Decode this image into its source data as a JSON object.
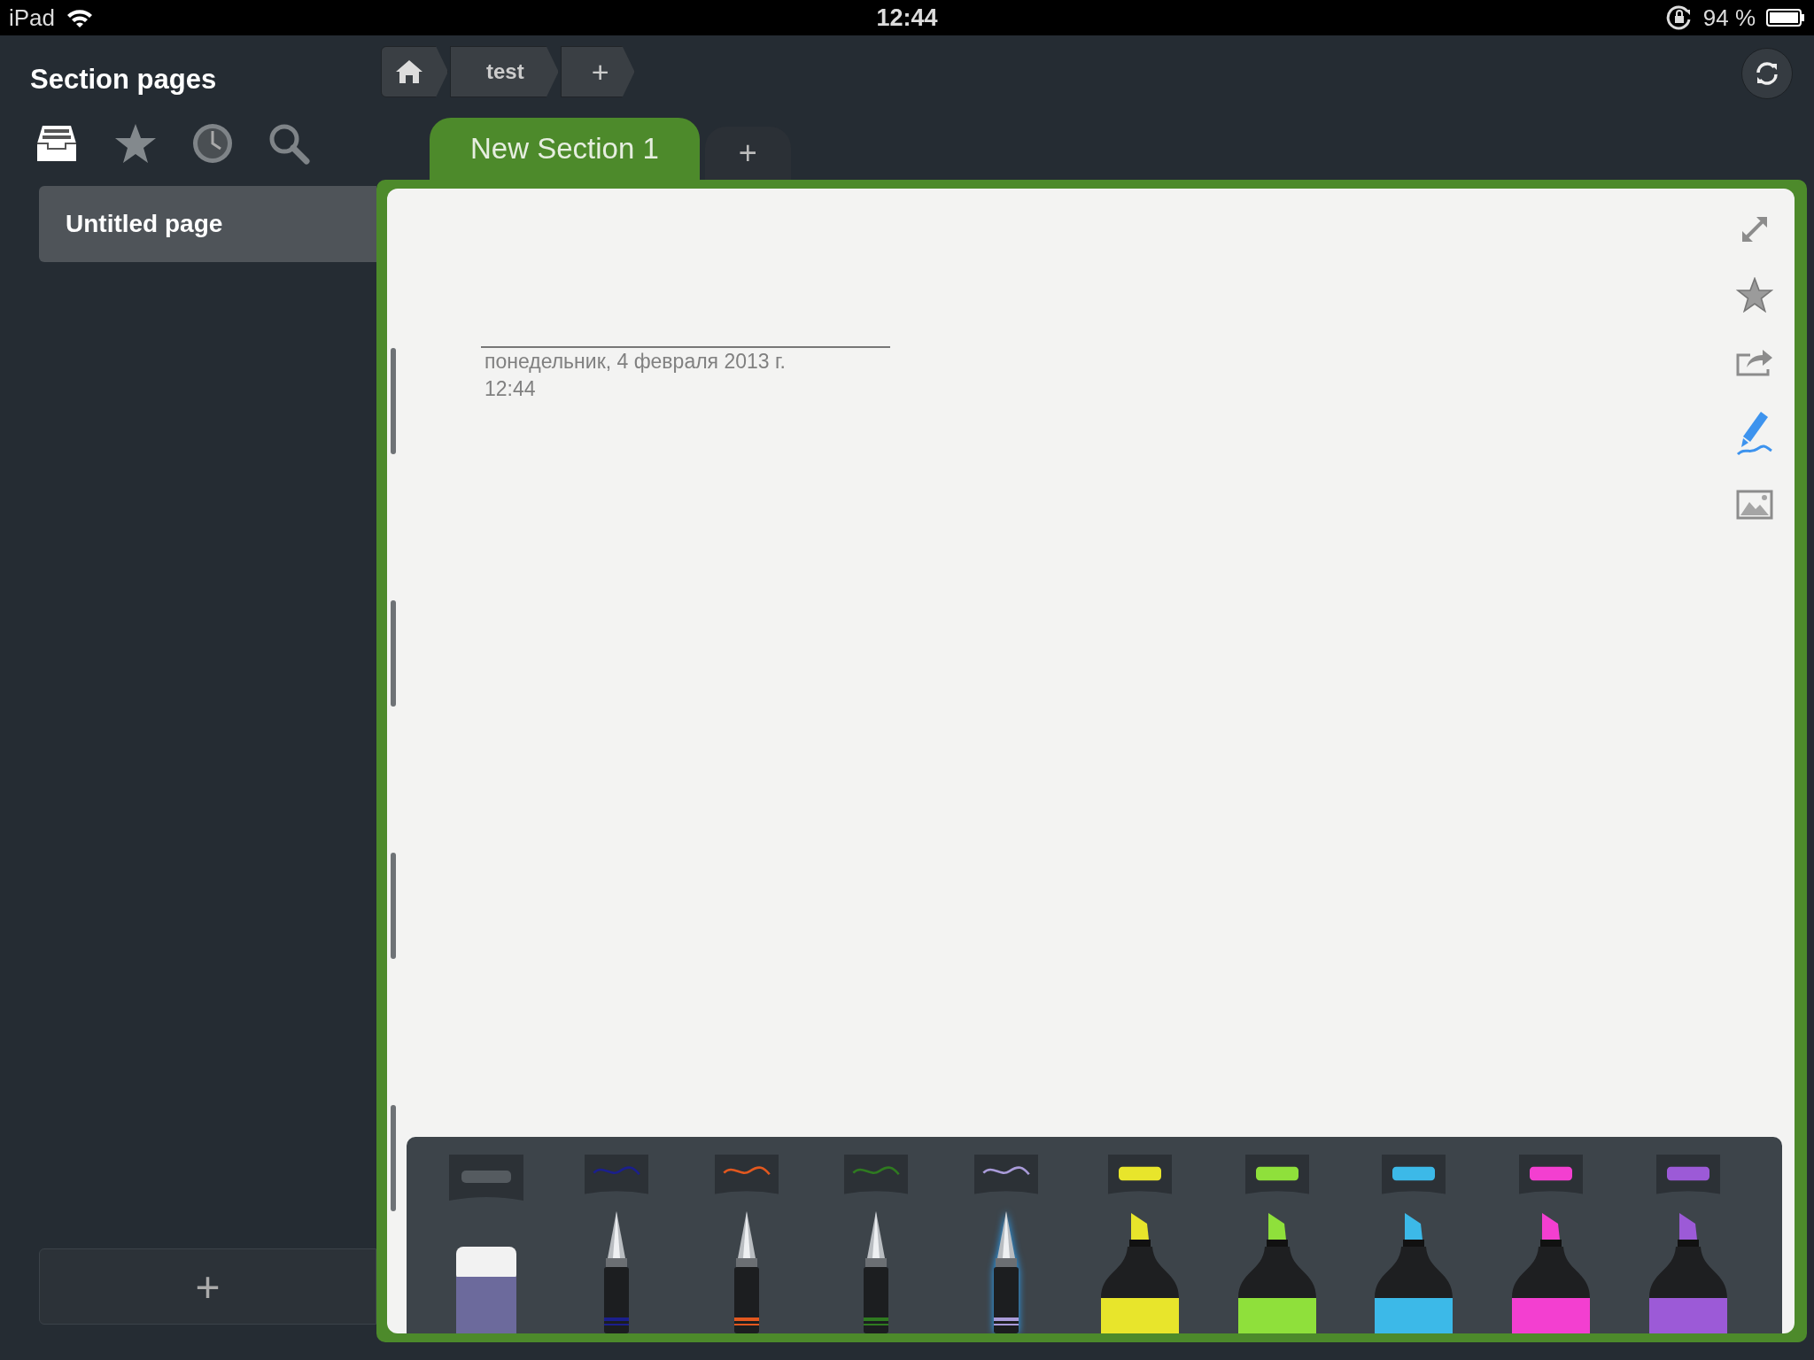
{
  "status_bar": {
    "device": "iPad",
    "time": "12:44",
    "battery": "94 %"
  },
  "sidebar": {
    "title": "Section pages",
    "view_buttons": [
      {
        "kind": "pages",
        "selected": true
      },
      {
        "kind": "favorites",
        "selected": false
      },
      {
        "kind": "recent",
        "selected": false
      },
      {
        "kind": "search",
        "selected": false
      }
    ],
    "pages": [
      {
        "label": "Untitled page",
        "selected": true
      }
    ],
    "add_button": "+"
  },
  "breadcrumb": [
    {
      "kind": "home"
    },
    {
      "kind": "notebook",
      "label": "test"
    },
    {
      "kind": "add",
      "label": "+"
    }
  ],
  "section_tabs": [
    {
      "label": "New Section 1",
      "selected": true,
      "color": "#4d8a2b"
    }
  ],
  "add_section": "+",
  "page": {
    "date": "понедельник, 4 февраля 2013 г.",
    "time": "12:44"
  },
  "page_tools": [
    {
      "kind": "expand",
      "active": false
    },
    {
      "kind": "favorite",
      "active": false
    },
    {
      "kind": "share",
      "active": false
    },
    {
      "kind": "draw",
      "active": true
    },
    {
      "kind": "picture",
      "active": false
    }
  ],
  "tools": [
    {
      "kind": "eraser",
      "color": "#555b60",
      "selected": false
    },
    {
      "kind": "pen",
      "color": "#1b1f8c",
      "selected": false
    },
    {
      "kind": "pen",
      "color": "#e2581f",
      "selected": false
    },
    {
      "kind": "pen",
      "color": "#2f7a20",
      "selected": false
    },
    {
      "kind": "pen",
      "color": "#a99bd9",
      "selected": true
    },
    {
      "kind": "highlighter",
      "color": "#e8e52b",
      "selected": false
    },
    {
      "kind": "highlighter",
      "color": "#8fe03b",
      "selected": false
    },
    {
      "kind": "highlighter",
      "color": "#3cb9e8",
      "selected": false
    },
    {
      "kind": "highlighter",
      "color": "#f33fd0",
      "selected": false
    },
    {
      "kind": "highlighter",
      "color": "#9c5ad7",
      "selected": false
    }
  ]
}
